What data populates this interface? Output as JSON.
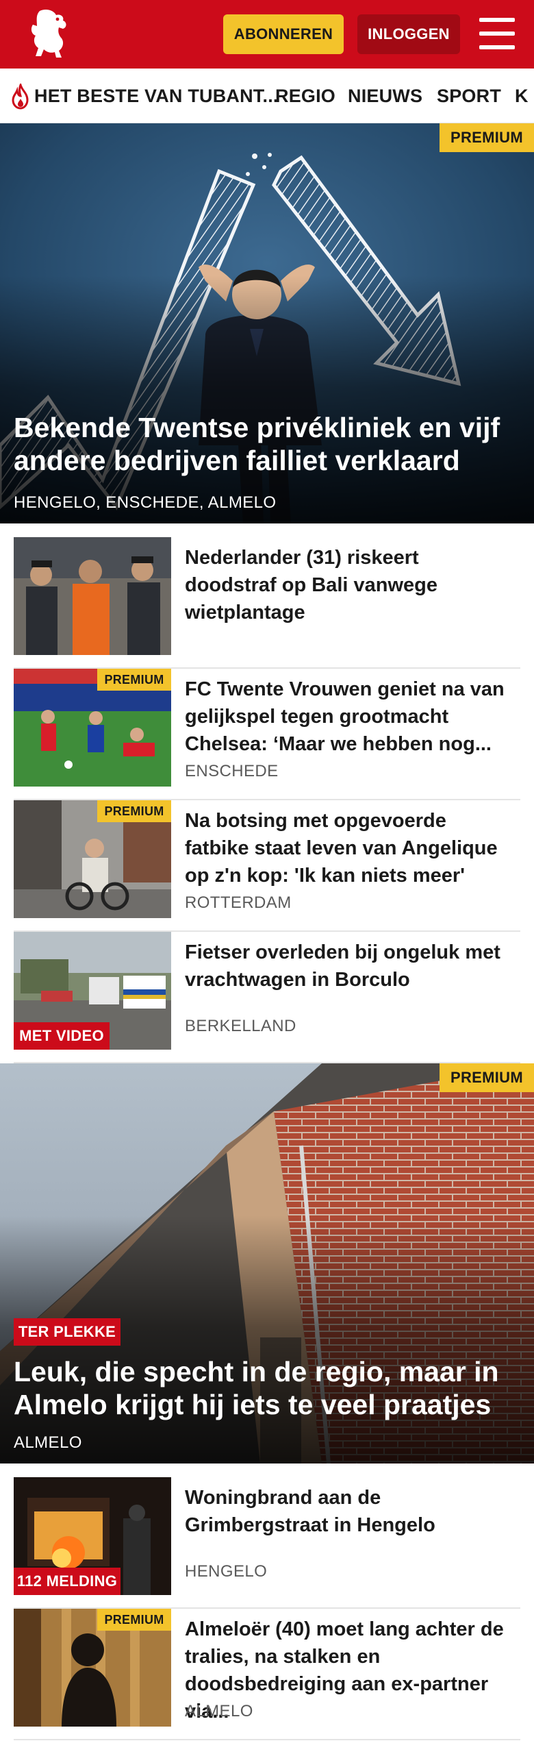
{
  "header": {
    "subscribe_label": "ABONNEREN",
    "login_label": "INLOGGEN",
    "brand_color": "#cc0b1a",
    "accent_color": "#f3c32b"
  },
  "nav": {
    "items": [
      "HET BESTE VAN TUBANT...",
      "REGIO",
      "NIEUWS",
      "SPORT",
      "K"
    ]
  },
  "hero1": {
    "badge": "PREMIUM",
    "title": "Bekende Twentse privékliniek en vijf andere bedrijven failliet verklaard",
    "locations": "HENGELO, ENSCHEDE, ALMELO"
  },
  "articles1": [
    {
      "title": "Nederlander (31) riskeert doodstraf op Bali vanwege wietplantage",
      "location": "",
      "badge": ""
    },
    {
      "title": "FC Twente Vrouwen geniet na van gelijkspel tegen grootmacht Chelsea: ‘Maar we hebben nog...",
      "location": "ENSCHEDE",
      "badge": "PREMIUM"
    },
    {
      "title": "Na botsing met opgevoerde fatbike staat leven van Angelique op z'n kop: 'Ik kan niets meer'",
      "location": "ROTTERDAM",
      "badge": "PREMIUM"
    },
    {
      "title": "Fietser overleden bij ongeluk met vrachtwagen in Borculo",
      "location": "BERKELLAND",
      "badge": "MET VIDEO"
    }
  ],
  "hero2": {
    "badge": "PREMIUM",
    "tag": "TER PLEKKE",
    "title": "Leuk, die specht in de regio, maar in Almelo krijgt hij iets te veel praatjes",
    "locations": "ALMELO"
  },
  "articles2": [
    {
      "title": "Woningbrand aan de Grimbergstraat in Hengelo",
      "location": "HENGELO",
      "badge": "112 MELDING"
    },
    {
      "title": "Almeloër (40) moet lang achter de tralies, na stalken en doodsbedreiging aan ex-partner via...",
      "location": "ALMELO",
      "badge": "PREMIUM"
    }
  ]
}
